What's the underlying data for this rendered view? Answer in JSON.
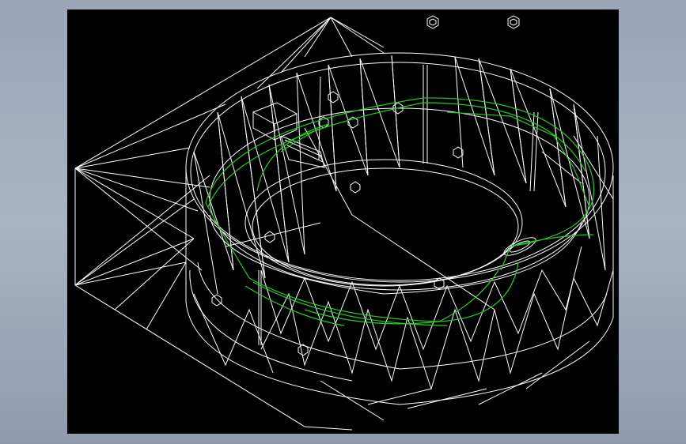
{
  "viewport": {
    "background_color": "#000000",
    "wireframe_color": "#ffffff",
    "highlight_color": "#22cc22"
  },
  "frame": {
    "background_color": "#a3aebd"
  }
}
